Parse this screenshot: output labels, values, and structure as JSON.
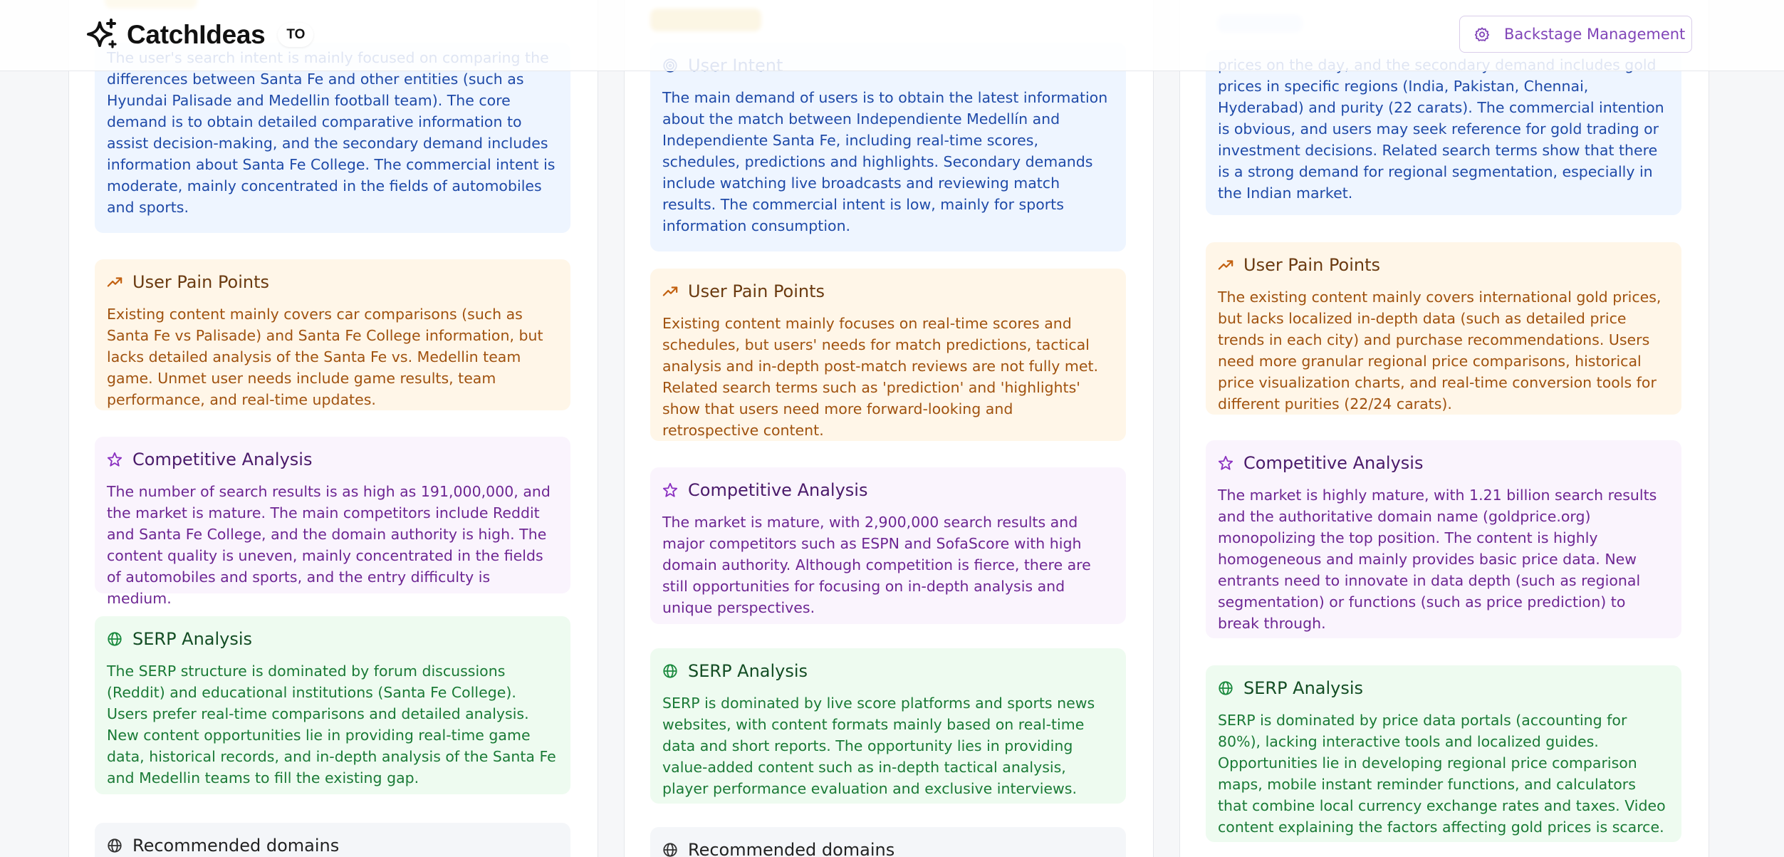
{
  "header": {
    "app_name": "CatchIdeas",
    "badge": "TO",
    "backstage_button": "Backstage Management"
  },
  "colors": {
    "intent": "#1f4aa8",
    "pain": "#a0520f",
    "competitive": "#6d2693",
    "serp": "#1a7a36",
    "accent": "#8145b8"
  },
  "columns": [
    {
      "intent_text": "The user's search intent is mainly focused on comparing the differences between Santa Fe and other entities (such as Hyundai Palisade and Medellin football team). The core demand is to obtain detailed comparative information to assist decision-making, and the secondary demand includes information about Santa Fe College. The commercial intent is moderate, mainly concentrated in the fields of automobiles and sports.",
      "pain_title": "User Pain Points",
      "pain_text": "Existing content mainly covers car comparisons (such as Santa Fe vs Palisade) and Santa Fe College information, but lacks detailed analysis of the Santa Fe vs. Medellin team game. Unmet user needs include game results, team performance, and real-time updates.",
      "comp_title": "Competitive Analysis",
      "comp_text": "The number of search results is as high as 191,000,000, and the market is mature. The main competitors include Reddit and Santa Fe College, and the domain authority is high. The content quality is uneven, mainly concentrated in the fields of automobiles and sports, and the entry difficulty is medium.",
      "serp_title": "SERP Analysis",
      "serp_text": "The SERP structure is dominated by forum discussions (Reddit) and educational institutions (Santa Fe College). Users prefer real-time comparisons and detailed analysis. New content opportunities lie in providing real-time game data, historical records, and in-depth analysis of the Santa Fe and Medellin teams to fill the existing gap.",
      "domains_title": "Recommended domains"
    },
    {
      "intent_title": "User Intent",
      "intent_text": "The main demand of users is to obtain the latest information about the match between Independiente Medellín and Independiente Santa Fe, including real-time scores, schedules, predictions and highlights. Secondary demands include watching live broadcasts and reviewing match results. The commercial intent is low, mainly for sports information consumption.",
      "pain_title": "User Pain Points",
      "pain_text": "Existing content mainly focuses on real-time scores and schedules, but users' needs for match predictions, tactical analysis and in-depth post-match reviews are not fully met. Related search terms such as 'prediction' and 'highlights' show that users need more forward-looking and retrospective content.",
      "comp_title": "Competitive Analysis",
      "comp_text": "The market is mature, with 2,900,000 search results and major competitors such as ESPN and SofaScore with high domain authority. Although competition is fierce, there are still opportunities for focusing on in-depth analysis and unique perspectives.",
      "serp_title": "SERP Analysis",
      "serp_text": "SERP is dominated by live score platforms and sports news websites, with content formats mainly based on real-time data and short reports. The opportunity lies in providing value-added content such as in-depth tactical analysis, player performance evaluation and exclusive interviews.",
      "domains_title": "Recommended domains"
    },
    {
      "intent_text": "prices on the day, and the secondary demand includes gold prices in specific regions (India, Pakistan, Chennai, Hyderabad) and purity (22 carats). The commercial intention is obvious, and users may seek reference for gold trading or investment decisions. Related search terms show that there is a strong demand for regional segmentation, especially in the Indian market.",
      "pain_title": "User Pain Points",
      "pain_text": "The existing content mainly covers international gold prices, but lacks localized in-depth data (such as detailed price trends in each city) and purchase recommendations. Users need more granular regional price comparisons, historical price visualization charts, and real-time conversion tools for different purities (22/24 carats).",
      "comp_title": "Competitive Analysis",
      "comp_text": "The market is highly mature, with 1.21 billion search results and the authoritative domain name (goldprice.org) monopolizing the top position. The content is highly homogeneous and mainly provides basic price data. New entrants need to innovate in data depth (such as regional segmentation) or functions (such as price prediction) to break through.",
      "serp_title": "SERP Analysis",
      "serp_text": "SERP is dominated by price data portals (accounting for 80%), lacking interactive tools and localized guides. Opportunities lie in developing regional price comparison maps, mobile instant reminder functions, and calculators that combine local currency exchange rates and taxes. Video content explaining the factors affecting gold prices is scarce."
    }
  ]
}
